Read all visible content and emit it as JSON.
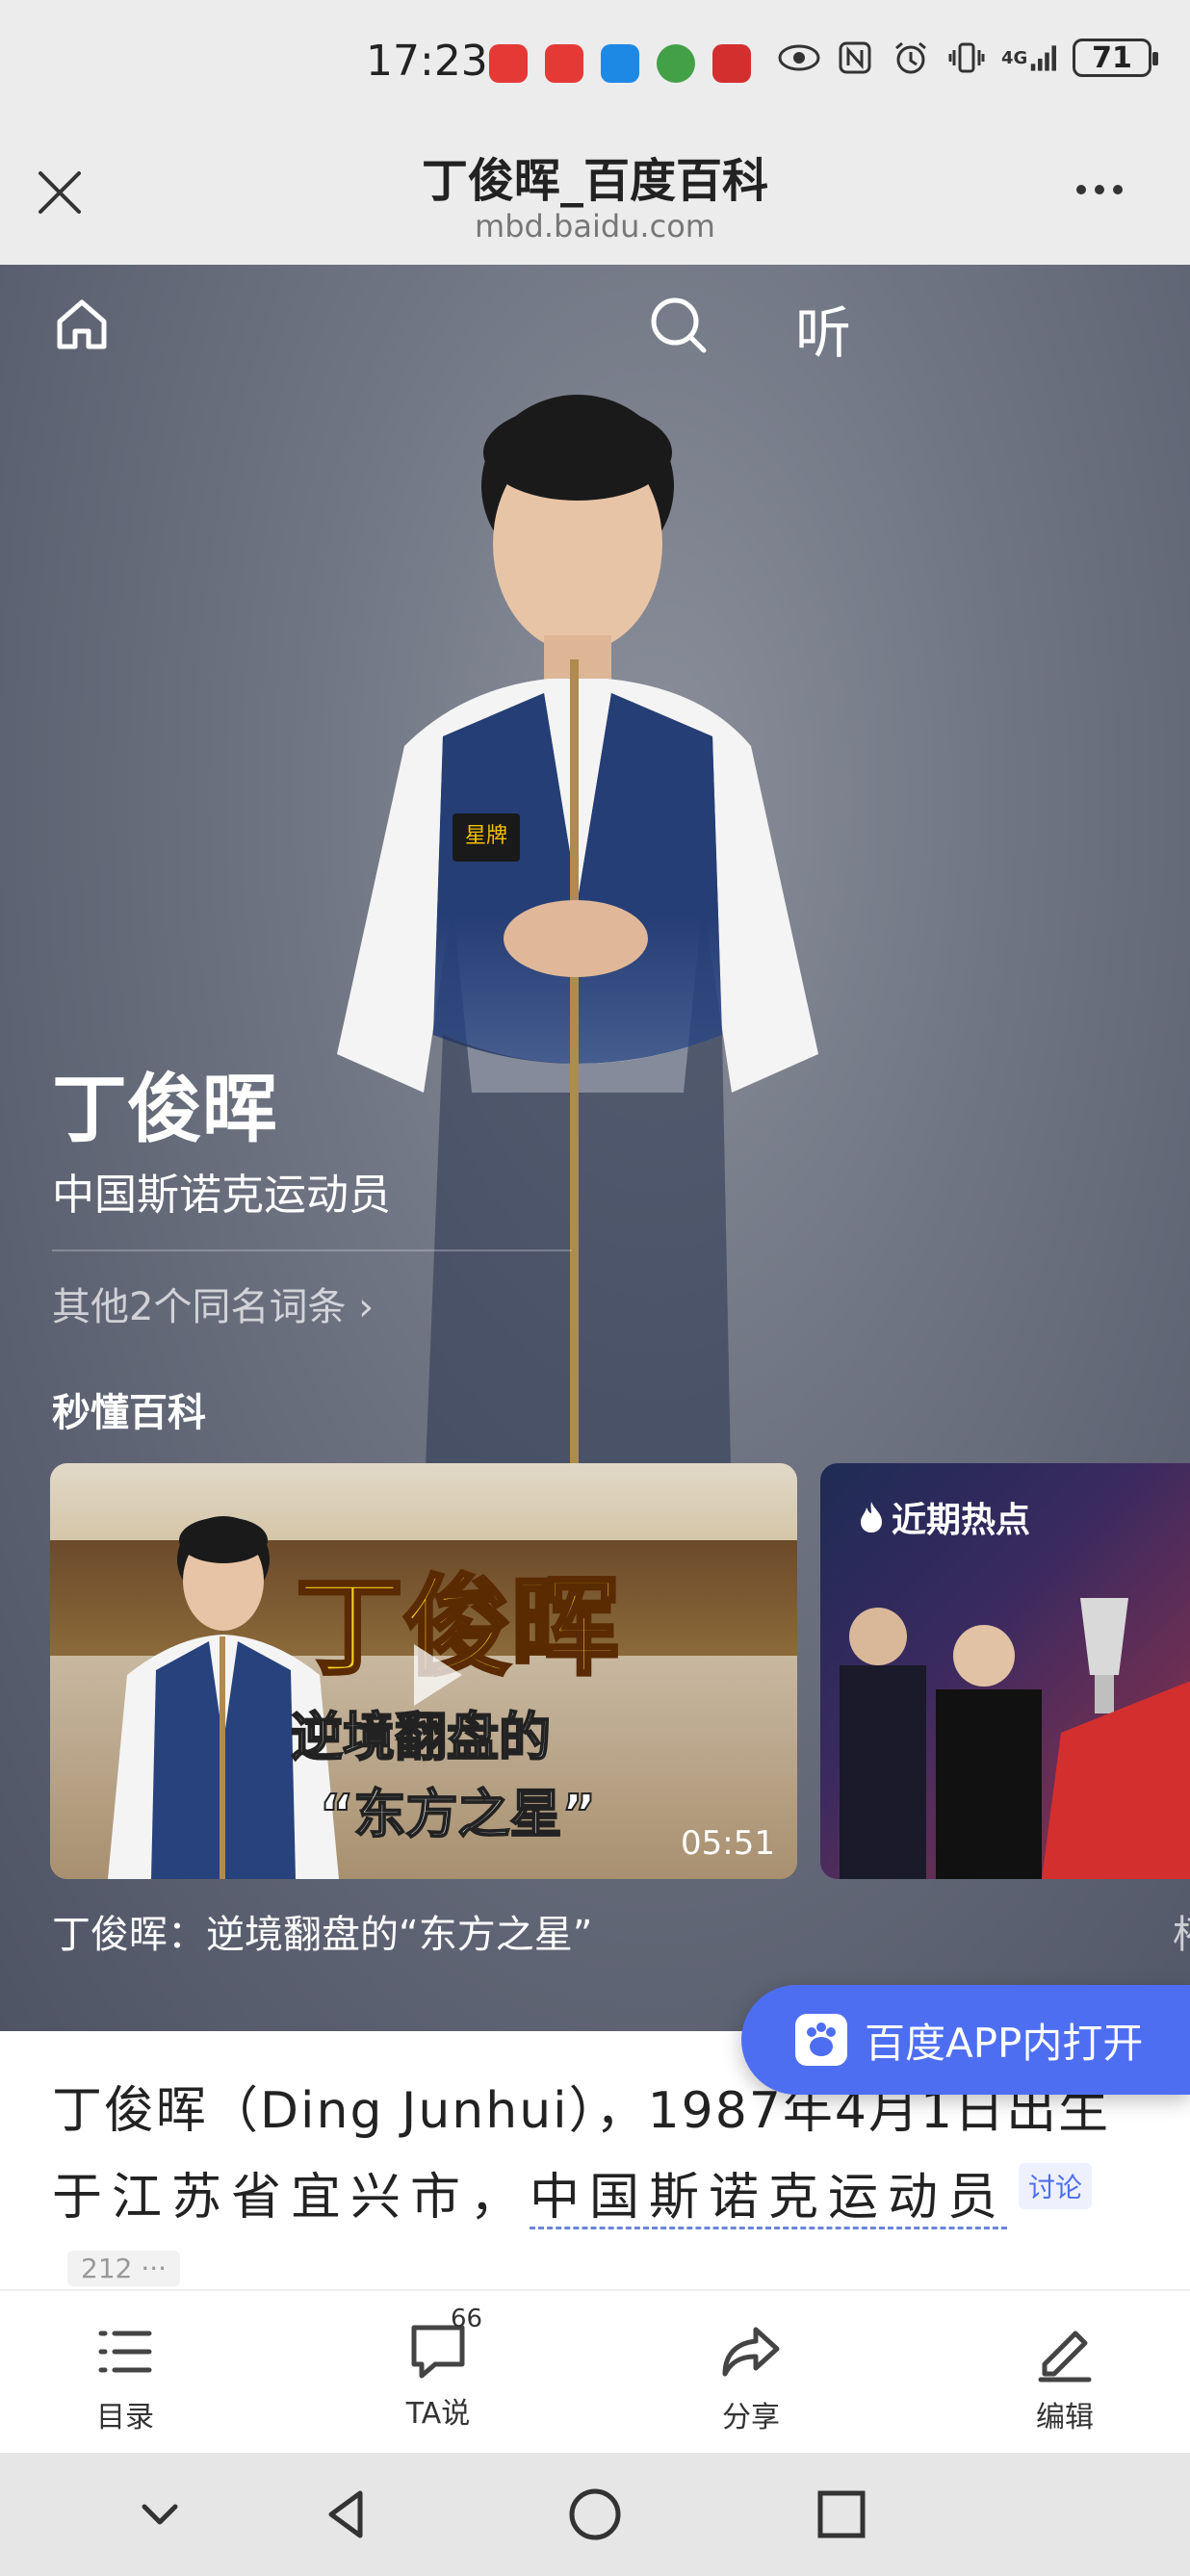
{
  "status_bar": {
    "time": "17:23",
    "network": "4G",
    "battery": "71",
    "app_icons": [
      "#e53935",
      "#e53935",
      "#1e88e5",
      "#43a047",
      "#d32f2f"
    ]
  },
  "titlebar": {
    "title": "丁俊晖_百度百科",
    "url": "mbd.baidu.com"
  },
  "hero": {
    "listen_label": "听",
    "name": "丁俊晖",
    "description": "中国斯诺克运动员",
    "homonym_link": "其他2个同名词条 ›",
    "section_title": "秒懂百科",
    "video1": {
      "title_text": "丁俊晖",
      "sub1": "逆境翻盘的",
      "sub2": "“东方之星”",
      "duration": "05:51",
      "caption": "丁俊晖：逆境翻盘的“东方之星”"
    },
    "video2": {
      "badge": "近期热点",
      "caption": "杯"
    }
  },
  "open_app": {
    "label": "百度APP内打开"
  },
  "intro": {
    "line1": "丁俊晖（Ding Junhui），1987年4月1日出生",
    "line2_prefix": "于江苏省宜兴市，",
    "line2_link": "中国斯诺克运动员",
    "discuss": "讨论",
    "count": "212 ···"
  },
  "toolbar": {
    "toc": "目录",
    "ta": "TA说",
    "ta_count": "66",
    "share": "分享",
    "edit": "编辑"
  }
}
